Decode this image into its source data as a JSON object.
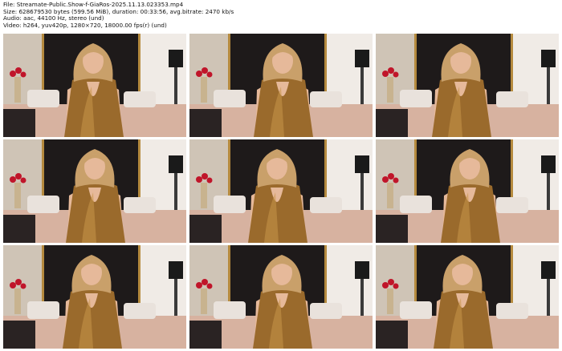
{
  "header": {
    "file_line": "File: Streamate-Public.Show-f-GiaRos-2025.11.13.023353.mp4",
    "size_line": "Size: 628679530 bytes (599.56 MiB), duration: 00:33:56, avg.bitrate: 2470 kb/s",
    "audio_line": "Audio: aac, 44100 Hz, stereo (und)",
    "video_line": "Video: h264, yuv420p, 1280×720, 18000.00 fps(r) (und)"
  },
  "thumbnails": [
    {
      "label": "thumb-1"
    },
    {
      "label": "thumb-2"
    },
    {
      "label": "thumb-3"
    },
    {
      "label": "thumb-4"
    },
    {
      "label": "thumb-5"
    },
    {
      "label": "thumb-6"
    },
    {
      "label": "thumb-7"
    },
    {
      "label": "thumb-8"
    },
    {
      "label": "thumb-9"
    }
  ],
  "colors": {
    "wall_left": "#cfc4b6",
    "headboard": "#1e1a1a",
    "gold_dress": "#9a6a2c",
    "hair": "#c9a06a",
    "skin": "#e6b99a",
    "bedsheet": "#d7b2a0",
    "lamp": "#1a1a1a",
    "wall_right": "#f0ebe6",
    "roses": "#c0152a"
  }
}
